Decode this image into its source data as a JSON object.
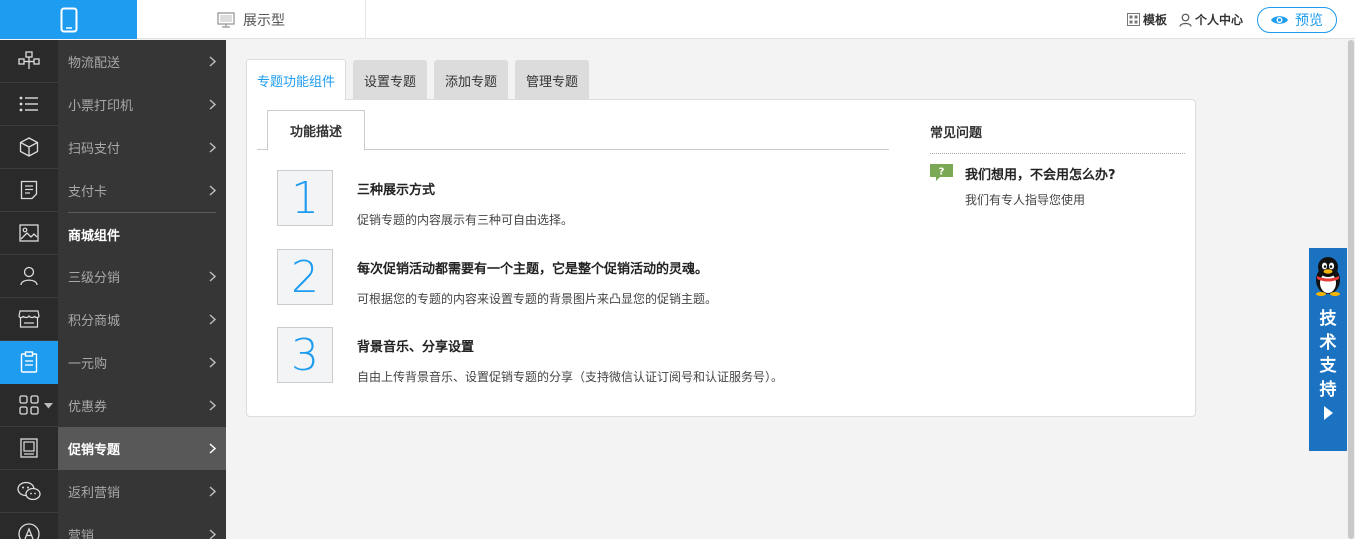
{
  "header": {
    "type_label": "展示型",
    "template_label": "模板",
    "user_center_label": "个人中心",
    "preview_label": "预览"
  },
  "sidebar": {
    "icons": [
      "org-chart-icon",
      "list-icon",
      "cube-icon",
      "notepad-icon",
      "image-icon",
      "person-icon",
      "store-icon",
      "clipboard-icon",
      "grid-icon",
      "frame-icon",
      "wechat-icon",
      "appstore-icon"
    ],
    "items_top": [
      {
        "label": "物流配送"
      },
      {
        "label": "小票打印机"
      },
      {
        "label": "扫码支付"
      },
      {
        "label": "支付卡"
      }
    ],
    "section_header": "商城组件",
    "items_bottom": [
      {
        "label": "三级分销"
      },
      {
        "label": "积分商城"
      },
      {
        "label": "一元购"
      },
      {
        "label": "优惠券"
      },
      {
        "label": "促销专题"
      },
      {
        "label": "返利营销"
      },
      {
        "label": "营销"
      }
    ]
  },
  "tabs": [
    {
      "label": "专题功能组件"
    },
    {
      "label": "设置专题"
    },
    {
      "label": "添加专题"
    },
    {
      "label": "管理专题"
    }
  ],
  "panel": {
    "inner_tab_label": "功能描述",
    "features": [
      {
        "num": "1",
        "title": "三种展示方式",
        "desc": "促销专题的内容展示有三种可自由选择。"
      },
      {
        "num": "2",
        "title": "每次促销活动都需要有一个主题，它是整个促销活动的灵魂。",
        "desc": "可根据您的专题的内容来设置专题的背景图片来凸显您的促销主题。"
      },
      {
        "num": "3",
        "title": "背景音乐、分享设置",
        "desc": "自由上传背景音乐、设置促销专题的分享（支持微信认证订阅号和认证服务号）。"
      }
    ]
  },
  "faq": {
    "title": "常见问题",
    "question": "我们想用，不会用怎么办?",
    "answer": "我们有专人指导您使用",
    "badge": "?"
  },
  "support": {
    "label": "技术支持"
  },
  "colors": {
    "accent": "#1e9cf0",
    "sidebar_dark": "#2a2a2a",
    "submenu": "#363636",
    "support_blue": "#1a72c0"
  }
}
